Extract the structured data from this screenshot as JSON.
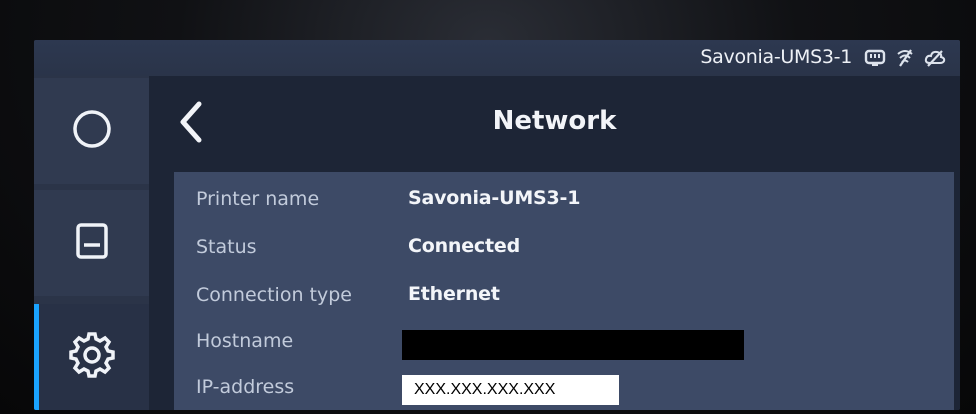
{
  "status_bar": {
    "printer_name": "Savonia-UMS3-1",
    "icons": [
      "network-icon",
      "wifi-off-icon",
      "cloud-off-icon"
    ]
  },
  "sidebar": {
    "items": [
      {
        "name": "print-status",
        "icon": "circle-icon"
      },
      {
        "name": "material",
        "icon": "material-icon"
      },
      {
        "name": "settings",
        "icon": "gear-icon",
        "active": true
      }
    ]
  },
  "header": {
    "title": "Network",
    "back_icon": "chevron-left-icon"
  },
  "network_info": {
    "rows": [
      {
        "label": "Printer name",
        "value": "Savonia-UMS3-1"
      },
      {
        "label": "Status",
        "value": "Connected"
      },
      {
        "label": "Connection type",
        "value": "Ethernet"
      },
      {
        "label": "Hostname",
        "value": ""
      },
      {
        "label": "IP-address",
        "value": "XXX.XXX.XXX.XXX"
      }
    ]
  },
  "colors": {
    "accent": "#1aa3ff",
    "panel": "#3d4a66",
    "background": "#1d2536"
  }
}
